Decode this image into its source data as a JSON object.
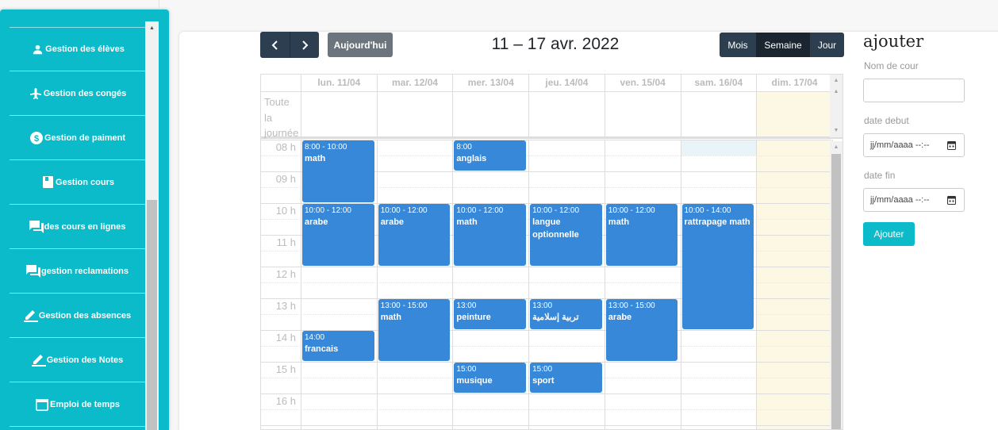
{
  "sidebar": {
    "items": [
      {
        "label": "Gestion des élèves",
        "icon": "person-icon"
      },
      {
        "label": "Gestion des congés",
        "icon": "airplane-icon"
      },
      {
        "label": "Gestion de paiment",
        "icon": "dollar-icon"
      },
      {
        "label": "Gestion cours",
        "icon": "book-icon"
      },
      {
        "label": "des cours en lignes",
        "icon": "chat-icon"
      },
      {
        "label": "gestion reclamations",
        "icon": "chat-icon"
      },
      {
        "label": "Gestion des absences",
        "icon": "pencil-icon"
      },
      {
        "label": "Gestion des Notes",
        "icon": "pencil-icon"
      },
      {
        "label": "Emploi de temps",
        "icon": "calendar-icon"
      }
    ]
  },
  "toolbar": {
    "today_label": "Aujourd'hui",
    "title": "11 – 17 avr. 2022",
    "views": {
      "month": "Mois",
      "week": "Semaine",
      "day": "Jour"
    }
  },
  "calendar": {
    "days": [
      "lun. 11/04",
      "mar. 12/04",
      "mer. 13/04",
      "jeu. 14/04",
      "ven. 15/04",
      "sam. 16/04",
      "dim. 17/04"
    ],
    "allday_label": "Toute la journée",
    "hours": [
      "08 h",
      "09 h",
      "10 h",
      "11 h",
      "12 h",
      "13 h",
      "14 h",
      "15 h",
      "16 h"
    ],
    "today_color": "#fcf8e3",
    "event_color": "#3788d8",
    "events": [
      {
        "day": 0,
        "start": 8,
        "end": 10,
        "time": "8:00 - 10:00",
        "title": "math"
      },
      {
        "day": 2,
        "start": 8,
        "end": 9,
        "time": "8:00",
        "title": "anglais"
      },
      {
        "day": 0,
        "start": 10,
        "end": 12,
        "time": "10:00 - 12:00",
        "title": "arabe"
      },
      {
        "day": 1,
        "start": 10,
        "end": 12,
        "time": "10:00 - 12:00",
        "title": "arabe"
      },
      {
        "day": 2,
        "start": 10,
        "end": 12,
        "time": "10:00 - 12:00",
        "title": "math"
      },
      {
        "day": 3,
        "start": 10,
        "end": 12,
        "time": "10:00 - 12:00",
        "title": "langue optionnelle"
      },
      {
        "day": 4,
        "start": 10,
        "end": 12,
        "time": "10:00 - 12:00",
        "title": "math"
      },
      {
        "day": 5,
        "start": 10,
        "end": 14,
        "time": "10:00 - 14:00",
        "title": "rattrapage math"
      },
      {
        "day": 1,
        "start": 13,
        "end": 15,
        "time": "13:00 - 15:00",
        "title": "math"
      },
      {
        "day": 2,
        "start": 13,
        "end": 14,
        "time": "13:00",
        "title": "peinture"
      },
      {
        "day": 3,
        "start": 13,
        "end": 14,
        "time": "13:00",
        "title": "تربية إسلامية"
      },
      {
        "day": 4,
        "start": 13,
        "end": 15,
        "time": "13:00 - 15:00",
        "title": "arabe"
      },
      {
        "day": 0,
        "start": 14,
        "end": 15,
        "time": "14:00",
        "title": "francais"
      },
      {
        "day": 2,
        "start": 15,
        "end": 16,
        "time": "15:00",
        "title": "musique"
      },
      {
        "day": 3,
        "start": 15,
        "end": 16,
        "time": "15:00",
        "title": "sport"
      }
    ]
  },
  "form": {
    "title": "ajouter",
    "name_label": "Nom de cour",
    "name_value": "",
    "start_label": "date debut",
    "start_placeholder": "jj/mm/aaaa --:--",
    "end_label": "date fin",
    "end_placeholder": "jj/mm/aaaa --:--",
    "submit_label": "Ajouter"
  }
}
